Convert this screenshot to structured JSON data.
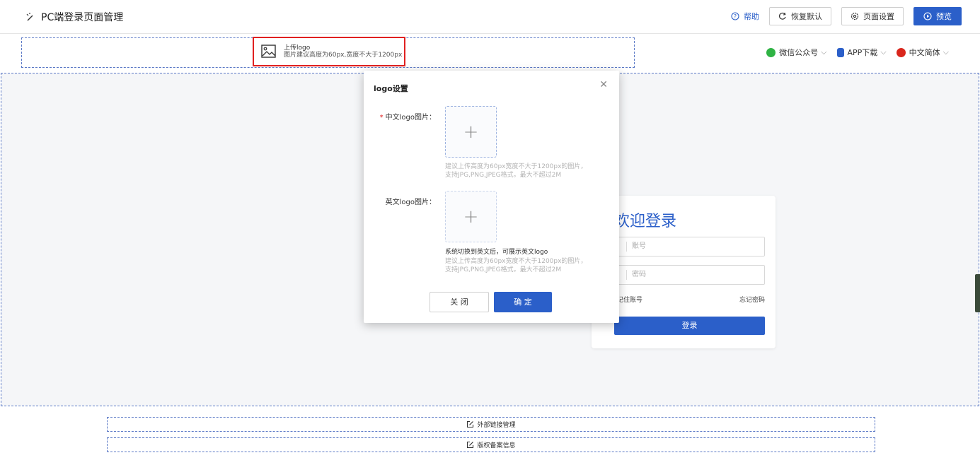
{
  "header": {
    "title": "PC端登录页面管理",
    "help_label": "帮助",
    "restore_label": "恢复默认",
    "page_settings_label": "页面设置",
    "preview_label": "预览"
  },
  "logo_area": {
    "upload_title": "上传logo",
    "upload_hint": "图片建议高度为60px,宽度不大于1200px"
  },
  "top_links": {
    "wechat_label": "微信公众号",
    "app_label": "APP下载",
    "lang_label": "中文简体"
  },
  "login_card": {
    "welcome": "欢迎登录",
    "account_placeholder": "账号",
    "password_placeholder": "密码",
    "remember_label": "记住账号",
    "forgot_label": "忘记密码",
    "login_button": "登录"
  },
  "footer": {
    "external_links_label": "外部链接管理",
    "copyright_label": "版权备案信息"
  },
  "modal": {
    "title": "logo设置",
    "cn_label": "中文logo图片：",
    "cn_required": "*",
    "cn_hint_1": "建议上传高度为60px宽度不大于1200px的图片，",
    "cn_hint_2": "支持JPG,PNG,JPEG格式，最大不超过2M",
    "en_label": "英文logo图片：",
    "en_note": "系统切换到英文后，可展示英文logo",
    "en_hint_1": "建议上传高度为60px宽度不大于1200px的图片，",
    "en_hint_2": "支持JPG,PNG,JPEG格式，最大不超过2M",
    "close_button": "关 闭",
    "ok_button": "确 定"
  },
  "colors": {
    "primary": "#2b5fc9",
    "highlight": "#e02020",
    "wechat": "#2fb344",
    "app": "#2b5fc9",
    "lang": "#d9261c"
  }
}
